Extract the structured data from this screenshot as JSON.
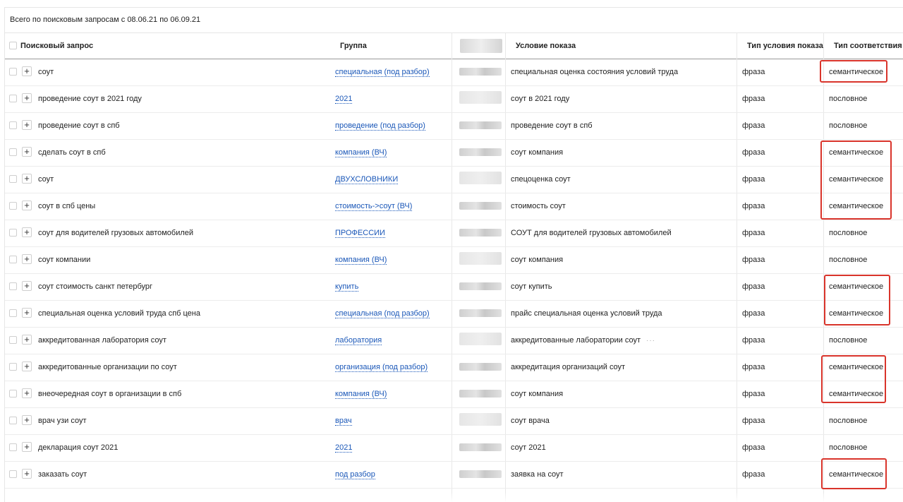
{
  "summary": "Всего по поисковым запросам с 08.06.21 по 06.09.21",
  "headers": {
    "query": "Поисковый запрос",
    "group": "Группа",
    "condition": "Условие показа",
    "condition_type": "Тип условия показа",
    "match_type": "Тип соответствия"
  },
  "rows": [
    {
      "query": "соут",
      "group": "специальная (под разбор)",
      "condition": "специальная оценка состояния условий труда",
      "condition_type": "фраза",
      "match_type": "семантическое"
    },
    {
      "query": "проведение соут в 2021 году",
      "group": "2021",
      "condition": "соут в 2021 году",
      "condition_type": "фраза",
      "match_type": "пословное"
    },
    {
      "query": "проведение соут в спб",
      "group": "проведение (под разбор)",
      "condition": "проведение соут в спб",
      "condition_type": "фраза",
      "match_type": "пословное"
    },
    {
      "query": "сделать соут в спб",
      "group": "компания (ВЧ)",
      "condition": "соут компания",
      "condition_type": "фраза",
      "match_type": "семантическое"
    },
    {
      "query": "соут",
      "group": "ДВУХСЛОВНИКИ",
      "condition": "спецоценка соут",
      "condition_type": "фраза",
      "match_type": "семантическое"
    },
    {
      "query": "соут в спб цены",
      "group": "стоимость->соут (ВЧ)",
      "condition": "стоимость соут",
      "condition_type": "фраза",
      "match_type": "семантическое"
    },
    {
      "query": "соут для водителей грузовых автомобилей",
      "group": "ПРОФЕССИИ",
      "condition": "СОУТ для водителей грузовых автомобилей",
      "condition_type": "фраза",
      "match_type": "пословное"
    },
    {
      "query": "соут компании",
      "group": "компания (ВЧ)",
      "condition": "соут компания",
      "condition_type": "фраза",
      "match_type": "пословное"
    },
    {
      "query": "соут стоимость санкт петербург",
      "group": "купить",
      "condition": "соут купить",
      "condition_type": "фраза",
      "match_type": "семантическое"
    },
    {
      "query": "специальная оценка условий труда спб цена",
      "group": "специальная (под разбор)",
      "condition": "прайс специальная оценка условий труда",
      "condition_type": "фраза",
      "match_type": "семантическое"
    },
    {
      "query": "аккредитованная лаборатория соут",
      "group": "лаборатория",
      "condition": "аккредитованные лаборатории соут",
      "condition_type": "фраза",
      "match_type": "пословное",
      "more": "···"
    },
    {
      "query": "аккредитованные организации по соут",
      "group": "организация (под разбор)",
      "condition": "аккредитация организаций соут",
      "condition_type": "фраза",
      "match_type": "семантическое"
    },
    {
      "query": "внеочередная соут в организации в спб",
      "group": "компания (ВЧ)",
      "condition": "соут компания",
      "condition_type": "фраза",
      "match_type": "семантическое"
    },
    {
      "query": "врач узи соут",
      "group": "врач",
      "condition": "соут врача",
      "condition_type": "фраза",
      "match_type": "пословное"
    },
    {
      "query": "декларация соут 2021",
      "group": "2021",
      "condition": "соут 2021",
      "condition_type": "фраза",
      "match_type": "пословное"
    },
    {
      "query": "заказать соут",
      "group": "под разбор",
      "condition": "заявка на соут",
      "condition_type": "фраза",
      "match_type": "семантическое"
    }
  ],
  "colors": {
    "link": "#1a57b8",
    "highlight": "#d9342b"
  }
}
